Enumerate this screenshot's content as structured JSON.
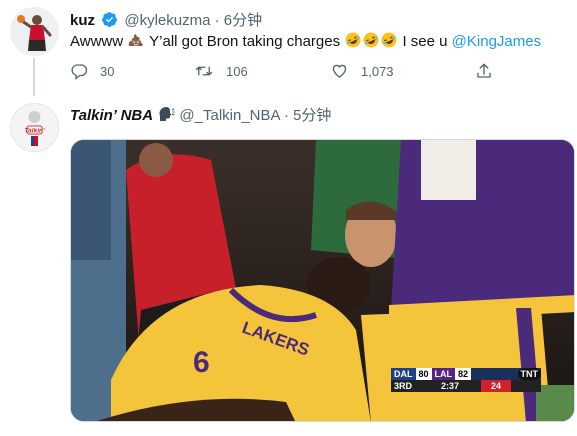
{
  "tweet1": {
    "name": "kuz",
    "handle": "@kylekuzma",
    "dot": "·",
    "time": "6分钟",
    "text_before": "Awwww",
    "text_middle": "Y’all got Bron taking charges",
    "text_after": "I see u",
    "mention": "@KingJames",
    "replies": "30",
    "retweets": "106",
    "likes": "1,073",
    "avatar_text": ""
  },
  "tweet2": {
    "name": "Talkin’ NBA",
    "handle": "@_Talkin_NBA",
    "dot": "·",
    "time": "5分钟",
    "avatar_text": "Talkin'"
  },
  "scorebug": {
    "away": "DAL",
    "away_score": "80",
    "home": "LAL",
    "home_score": "82",
    "quarter": "3RD",
    "clock": "2:37",
    "shot_clock": "24",
    "network": "TNT"
  },
  "jersey": {
    "team": "LAKERS",
    "number": "6"
  },
  "colors": {
    "link": "#1d9bf0",
    "text": "#0f1419",
    "muted": "#536471",
    "lakers_gold": "#f4c53a",
    "lakers_purple": "#4b2a7b"
  },
  "icons": {
    "reply": "reply-icon",
    "retweet": "retweet-icon",
    "like": "heart-icon",
    "share": "share-icon",
    "verified": "verified-badge-icon",
    "emoji_poop": "poop-emoji-icon",
    "emoji_laugh": "rofl-emoji-icon",
    "emoji_speaking": "speaking-head-emoji-icon"
  }
}
